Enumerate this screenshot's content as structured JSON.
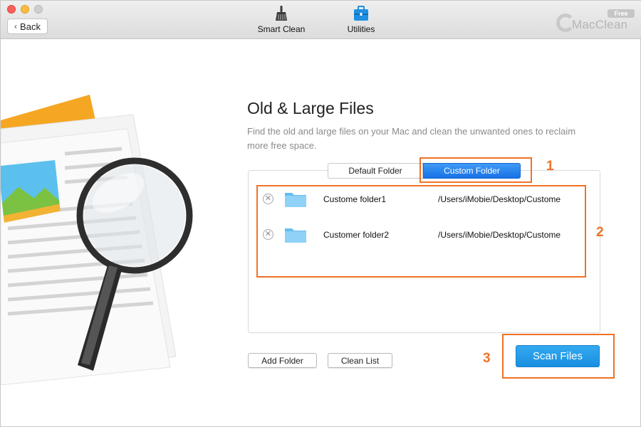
{
  "window": {
    "back_label": "Back",
    "nav": [
      {
        "label": "Smart Clean",
        "icon": "broom-icon"
      },
      {
        "label": "Utilities",
        "icon": "toolbox-icon"
      }
    ],
    "brand": {
      "name": "MacClean",
      "badge": "Free"
    }
  },
  "main": {
    "title": "Old & Large Files",
    "description": "Find the old and large files on your Mac and clean the unwanted ones to reclaim more free space.",
    "tabs": [
      {
        "label": "Default Folder",
        "selected": false
      },
      {
        "label": "Custom Folder",
        "selected": true
      }
    ],
    "folders": [
      {
        "name": "Custome folder1",
        "path": "/Users/iMobie/Desktop/Custome"
      },
      {
        "name": "Customer folder2",
        "path": "/Users/iMobie/Desktop/Custome"
      }
    ],
    "add_folder_label": "Add Folder",
    "clean_list_label": "Clean List",
    "scan_label": "Scan Files"
  },
  "annotations": {
    "step1": "1",
    "step2": "2",
    "step3": "3"
  },
  "colors": {
    "accent_blue": "#1a8fe0",
    "segment_blue": "#1772e5",
    "callout_orange": "#f07226",
    "folder_blue": "#64bdf2"
  }
}
